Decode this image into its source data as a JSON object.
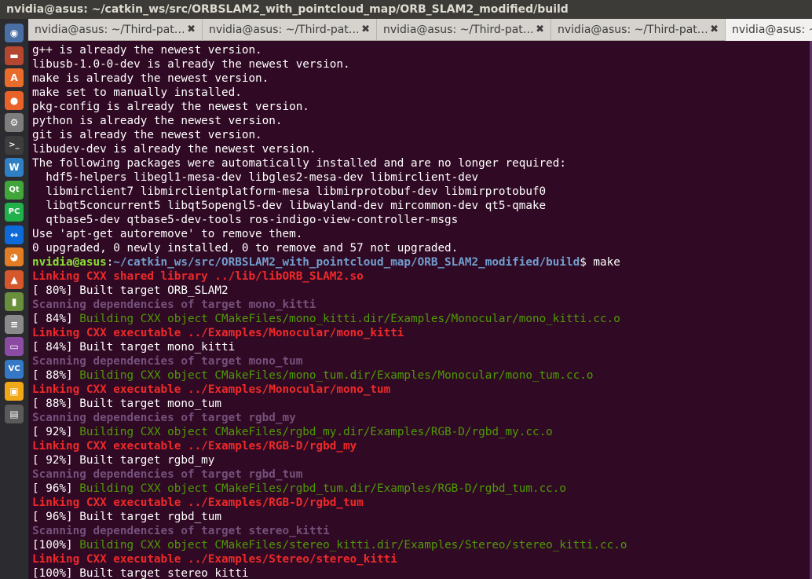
{
  "window": {
    "title": "nvidia@asus: ~/catkin_ws/src/ORBSLAM2_with_pointcloud_map/ORB_SLAM2_modified/build"
  },
  "launcher": {
    "items": [
      {
        "name": "ubuntu-dash-icon",
        "glyph": "◉",
        "color": "#4a6fa5"
      },
      {
        "name": "files-icon",
        "glyph": "▬",
        "color": "#b5462f"
      },
      {
        "name": "software-center-icon",
        "glyph": "A",
        "color": "#e96c2c"
      },
      {
        "name": "firefox-icon",
        "glyph": "●",
        "color": "#e9622a"
      },
      {
        "name": "settings-icon",
        "glyph": "⚙",
        "color": "#7d7d7d"
      },
      {
        "name": "terminal-icon",
        "glyph": ">_",
        "color": "#3d3d3d",
        "active": true
      },
      {
        "name": "writer-icon",
        "glyph": "W",
        "color": "#2e7fc4"
      },
      {
        "name": "qt-creator-icon",
        "glyph": "Qt",
        "color": "#41a53b"
      },
      {
        "name": "pycharm-icon",
        "glyph": "PC",
        "color": "#21b14a"
      },
      {
        "name": "teamviewer-icon",
        "glyph": "↔",
        "color": "#0e6ad8"
      },
      {
        "name": "blender-icon",
        "glyph": "◕",
        "color": "#e27d25"
      },
      {
        "name": "matlab-icon",
        "glyph": "▲",
        "color": "#d4582b"
      },
      {
        "name": "battery-icon",
        "glyph": "▮",
        "color": "#6a8f3c"
      },
      {
        "name": "document-icon",
        "glyph": "≡",
        "color": "#8a8a8a"
      },
      {
        "name": "window-icon",
        "glyph": "▭",
        "color": "#8c4ba3"
      },
      {
        "name": "vscode-icon",
        "glyph": "VC",
        "color": "#3478c6"
      },
      {
        "name": "virtualbox-icon",
        "glyph": "▣",
        "color": "#f0a818"
      },
      {
        "name": "workspace-icon",
        "glyph": "▤",
        "color": "#5a5a5a"
      }
    ]
  },
  "tabs": [
    {
      "label": "nvidia@asus: ~/Third-pat…",
      "close": "✖"
    },
    {
      "label": "nvidia@asus: ~/Third-pat…",
      "close": "✖"
    },
    {
      "label": "nvidia@asus: ~/Third-pat…",
      "close": "✖"
    },
    {
      "label": "nvidia@asus: ~/Third-pat…",
      "close": "✖"
    },
    {
      "label": "nvidia@asus: ~/",
      "close": "",
      "active": true
    }
  ],
  "terminal": {
    "lines": [
      [
        {
          "t": "g++ is already the newest version.",
          "c": "white"
        }
      ],
      [
        {
          "t": "libusb-1.0-0-dev is already the newest version.",
          "c": "white"
        }
      ],
      [
        {
          "t": "make is already the newest version.",
          "c": "white"
        }
      ],
      [
        {
          "t": "make set to manually installed.",
          "c": "white"
        }
      ],
      [
        {
          "t": "pkg-config is already the newest version.",
          "c": "white"
        }
      ],
      [
        {
          "t": "python is already the newest version.",
          "c": "white"
        }
      ],
      [
        {
          "t": "git is already the newest version.",
          "c": "white"
        }
      ],
      [
        {
          "t": "libudev-dev is already the newest version.",
          "c": "white"
        }
      ],
      [
        {
          "t": "The following packages were automatically installed and are no longer required:",
          "c": "white"
        }
      ],
      [
        {
          "t": "  hdf5-helpers libegl1-mesa-dev libgles2-mesa-dev libmirclient-dev",
          "c": "white"
        }
      ],
      [
        {
          "t": "  libmirclient7 libmirclientplatform-mesa libmirprotobuf-dev libmirprotobuf0",
          "c": "white"
        }
      ],
      [
        {
          "t": "  libqt5concurrent5 libqt5opengl5-dev libwayland-dev mircommon-dev qt5-qmake",
          "c": "white"
        }
      ],
      [
        {
          "t": "  qtbase5-dev qtbase5-dev-tools ros-indigo-view-controller-msgs",
          "c": "white"
        }
      ],
      [
        {
          "t": "Use 'apt-get autoremove' to remove them.",
          "c": "white"
        }
      ],
      [
        {
          "t": "0 upgraded, 0 newly installed, 0 to remove and 57 not upgraded.",
          "c": "white"
        }
      ],
      [
        {
          "t": "nvidia@asus",
          "c": "prompt-user"
        },
        {
          "t": ":",
          "c": "white"
        },
        {
          "t": "~/catkin_ws/src/ORBSLAM2_with_pointcloud_map/ORB_SLAM2_modified/build",
          "c": "prompt-path"
        },
        {
          "t": "$ make",
          "c": "white"
        }
      ],
      [
        {
          "t": "Linking CXX shared library ../lib/libORB_SLAM2.so",
          "c": "red-bold"
        }
      ],
      [
        {
          "t": "[ 80%] Built target ORB_SLAM2",
          "c": "white"
        }
      ],
      [
        {
          "t": "Scanning dependencies of target mono_kitti",
          "c": "magenta-bold"
        }
      ],
      [
        {
          "t": "[ 84%] ",
          "c": "white"
        },
        {
          "t": "Building CXX object CMakeFiles/mono_kitti.dir/Examples/Monocular/mono_kitti.cc.o",
          "c": "green"
        }
      ],
      [
        {
          "t": "Linking CXX executable ../Examples/Monocular/mono_kitti",
          "c": "red-bold"
        }
      ],
      [
        {
          "t": "[ 84%] Built target mono_kitti",
          "c": "white"
        }
      ],
      [
        {
          "t": "Scanning dependencies of target mono_tum",
          "c": "magenta-bold"
        }
      ],
      [
        {
          "t": "[ 88%] ",
          "c": "white"
        },
        {
          "t": "Building CXX object CMakeFiles/mono_tum.dir/Examples/Monocular/mono_tum.cc.o",
          "c": "green"
        }
      ],
      [
        {
          "t": "Linking CXX executable ../Examples/Monocular/mono_tum",
          "c": "red-bold"
        }
      ],
      [
        {
          "t": "[ 88%] Built target mono_tum",
          "c": "white"
        }
      ],
      [
        {
          "t": "Scanning dependencies of target rgbd_my",
          "c": "magenta-bold"
        }
      ],
      [
        {
          "t": "[ 92%] ",
          "c": "white"
        },
        {
          "t": "Building CXX object CMakeFiles/rgbd_my.dir/Examples/RGB-D/rgbd_my.cc.o",
          "c": "green"
        }
      ],
      [
        {
          "t": "Linking CXX executable ../Examples/RGB-D/rgbd_my",
          "c": "red-bold"
        }
      ],
      [
        {
          "t": "[ 92%] Built target rgbd_my",
          "c": "white"
        }
      ],
      [
        {
          "t": "Scanning dependencies of target rgbd_tum",
          "c": "magenta-bold"
        }
      ],
      [
        {
          "t": "[ 96%] ",
          "c": "white"
        },
        {
          "t": "Building CXX object CMakeFiles/rgbd_tum.dir/Examples/RGB-D/rgbd_tum.cc.o",
          "c": "green"
        }
      ],
      [
        {
          "t": "Linking CXX executable ../Examples/RGB-D/rgbd_tum",
          "c": "red-bold"
        }
      ],
      [
        {
          "t": "[ 96%] Built target rgbd_tum",
          "c": "white"
        }
      ],
      [
        {
          "t": "Scanning dependencies of target stereo_kitti",
          "c": "magenta-bold"
        }
      ],
      [
        {
          "t": "[100%] ",
          "c": "white"
        },
        {
          "t": "Building CXX object CMakeFiles/stereo_kitti.dir/Examples/Stereo/stereo_kitti.cc.o",
          "c": "green"
        }
      ],
      [
        {
          "t": "Linking CXX executable ../Examples/Stereo/stereo_kitti",
          "c": "red-bold"
        }
      ],
      [
        {
          "t": "[100%] Built target stereo_kitti",
          "c": "white"
        }
      ]
    ]
  }
}
